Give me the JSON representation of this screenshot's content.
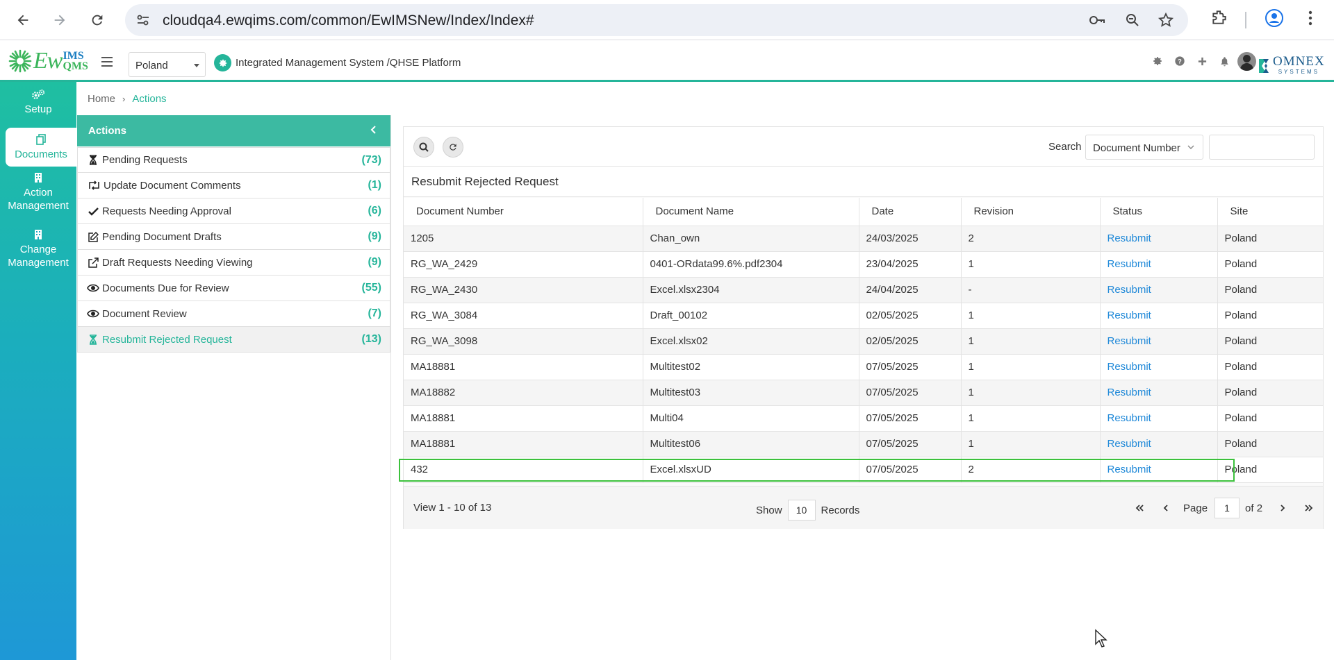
{
  "browser": {
    "url": "cloudqa4.ewqims.com/common/EwIMSNew/Index/Index#"
  },
  "header": {
    "logo": {
      "main": "Ew",
      "top": "IMS",
      "bottom": "QMS"
    },
    "site_value": "Poland",
    "platform_title": "Integrated Management System /QHSE Platform",
    "brand": {
      "name": "OMNEX",
      "tag": "SYSTEMS"
    }
  },
  "sidenav": {
    "items": [
      {
        "label": "Setup",
        "icon": "gears-icon"
      },
      {
        "label": "Documents",
        "icon": "documents-icon"
      },
      {
        "label": "Action Management",
        "icon": "building-icon"
      },
      {
        "label": "Change Management",
        "icon": "building-icon"
      }
    ]
  },
  "breadcrumb": {
    "home": "Home",
    "current": "Actions"
  },
  "actions": {
    "title": "Actions",
    "items": [
      {
        "label": "Pending Requests",
        "count": "(73)",
        "icon": "hourglass-icon"
      },
      {
        "label": "Update Document Comments",
        "count": "(1)",
        "icon": "retweet-icon"
      },
      {
        "label": "Requests Needing Approval",
        "count": "(6)",
        "icon": "check-icon"
      },
      {
        "label": "Pending Document Drafts",
        "count": "(9)",
        "icon": "edit-icon"
      },
      {
        "label": "Draft Requests Needing Viewing",
        "count": "(9)",
        "icon": "share-icon"
      },
      {
        "label": "Documents Due for Review",
        "count": "(55)",
        "icon": "eye-icon"
      },
      {
        "label": "Document Review",
        "count": "(7)",
        "icon": "eye-icon"
      },
      {
        "label": "Resubmit Rejected Request",
        "count": "(13)",
        "icon": "hourglass-icon"
      }
    ]
  },
  "grid": {
    "search_label": "Search",
    "search_field": "Document Number",
    "title": "Resubmit Rejected Request",
    "columns": [
      "Document Number",
      "Document Name",
      "Date",
      "Revision",
      "Status",
      "Site"
    ],
    "rows": [
      [
        "1205",
        "Chan_own",
        "24/03/2025",
        "2",
        "Resubmit",
        "Poland"
      ],
      [
        "RG_WA_2429",
        "0401-ORdata99.6%.pdf2304",
        "23/04/2025",
        "1",
        "Resubmit",
        "Poland"
      ],
      [
        "RG_WA_2430",
        "Excel.xlsx2304",
        "24/04/2025",
        "-",
        "Resubmit",
        "Poland"
      ],
      [
        "RG_WA_3084",
        "Draft_00102",
        "02/05/2025",
        "1",
        "Resubmit",
        "Poland"
      ],
      [
        "RG_WA_3098",
        "Excel.xlsx02",
        "02/05/2025",
        "1",
        "Resubmit",
        "Poland"
      ],
      [
        "MA18881",
        "Multitest02",
        "07/05/2025",
        "1",
        "Resubmit",
        "Poland"
      ],
      [
        "MA18882",
        "Multitest03",
        "07/05/2025",
        "1",
        "Resubmit",
        "Poland"
      ],
      [
        "MA18881",
        "Multi04",
        "07/05/2025",
        "1",
        "Resubmit",
        "Poland"
      ],
      [
        "MA18881",
        "Multitest06",
        "07/05/2025",
        "1",
        "Resubmit",
        "Poland"
      ],
      [
        "432",
        "Excel.xlsxUD",
        "07/05/2025",
        "2",
        "Resubmit",
        "Poland"
      ]
    ],
    "pager": {
      "view": "View 1 - 10 of 13",
      "show_label": "Show",
      "page_size": "10",
      "records_label": "Records",
      "page_label": "Page",
      "page": "1",
      "of_label": "of 2"
    }
  },
  "colors": {
    "accent": "#25b59a",
    "link": "#1e88d8",
    "highlight": "#3cc13c"
  }
}
